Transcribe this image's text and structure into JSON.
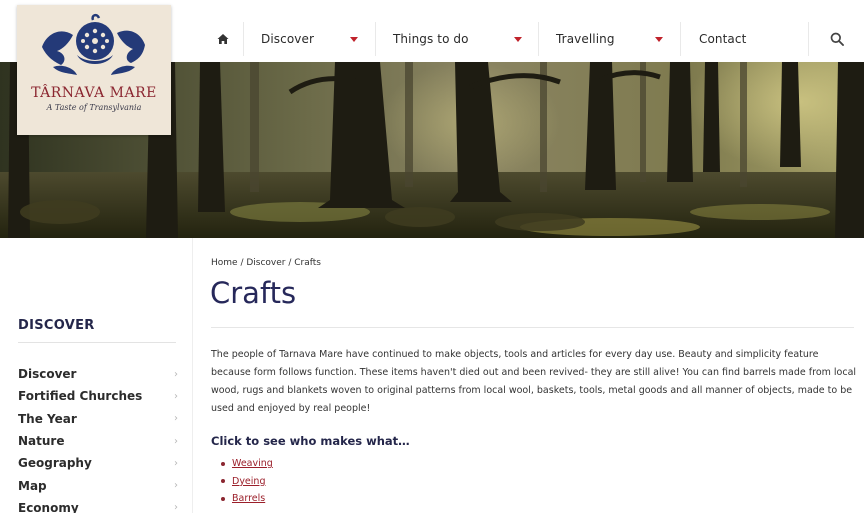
{
  "brand": {
    "title": "TÂRNAVA MARE",
    "subtitle": "A Taste of Transylvania"
  },
  "nav": {
    "home_icon": "home-icon",
    "items": [
      {
        "label": "Discover",
        "has_dropdown": true
      },
      {
        "label": "Things to do",
        "has_dropdown": true
      },
      {
        "label": "Travelling",
        "has_dropdown": true
      },
      {
        "label": "Contact",
        "has_dropdown": false
      }
    ],
    "search_icon": "search-icon"
  },
  "sidebar": {
    "title": "DISCOVER",
    "items": [
      {
        "label": "Discover"
      },
      {
        "label": "Fortified Churches"
      },
      {
        "label": "The Year"
      },
      {
        "label": "Nature"
      },
      {
        "label": "Geography"
      },
      {
        "label": "Map"
      },
      {
        "label": "Economy"
      }
    ]
  },
  "main": {
    "breadcrumb": "Home / Discover / Crafts",
    "title": "Crafts",
    "intro": "The people of Tarnava Mare have continued to make objects, tools and articles for every day use. Beauty and simplicity feature because form follows function. These items haven't died out and been revived- they are still alive! You can find barrels made from local wood, rugs and blankets woven to original patterns from local wool, baskets, tools, metal goods and all manner of objects, made to be used and enjoyed by real people!",
    "click_heading": "Click to see who makes what…",
    "crafts": [
      {
        "label": "Weaving"
      },
      {
        "label": "Dyeing"
      },
      {
        "label": "Barrels"
      }
    ]
  },
  "colors": {
    "accent": "#c0222b",
    "title_navy": "#26285a",
    "link": "#9b1f2a",
    "logo_bg": "#efe6d8"
  }
}
